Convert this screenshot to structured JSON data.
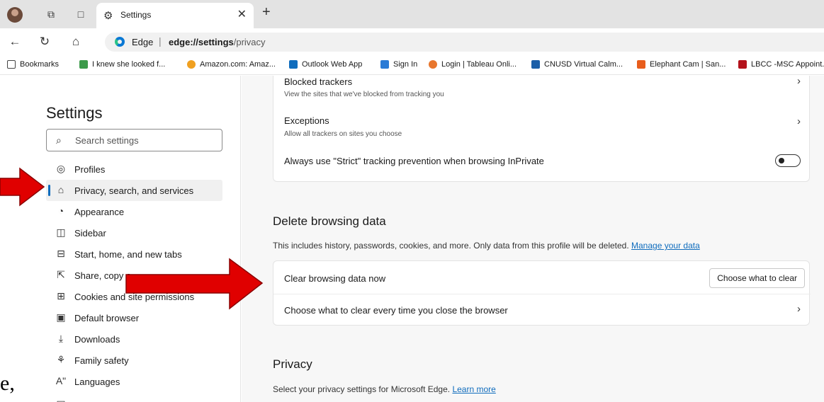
{
  "tab": {
    "title": "Settings"
  },
  "address": {
    "label": "Edge",
    "url_bold": "edge://settings",
    "url_rest": "/privacy"
  },
  "bookmarks": [
    {
      "label": "Bookmarks",
      "icon": "bookmarks-folder-icon",
      "color": "#444444"
    },
    {
      "label": "I knew she looked f...",
      "icon": "site-favicon",
      "color": "#3c9a4a"
    },
    {
      "label": "Amazon.com: Amaz...",
      "icon": "amazon-icon",
      "color": "#f0a020"
    },
    {
      "label": "Outlook Web App",
      "icon": "outlook-icon",
      "color": "#0f6cbd"
    },
    {
      "label": "Sign In",
      "icon": "signin-icon",
      "color": "#2a7bd6"
    },
    {
      "label": "Login | Tableau Onli...",
      "icon": "tableau-icon",
      "color": "#e8762d"
    },
    {
      "label": "CNUSD Virtual Calm...",
      "icon": "calendar-icon",
      "color": "#1c5fa8"
    },
    {
      "label": "Elephant Cam | San...",
      "icon": "elephant-cam-icon",
      "color": "#e85d1c"
    },
    {
      "label": "LBCC -MSC Appoint...",
      "icon": "lbcc-icon",
      "color": "#b3121b"
    }
  ],
  "sidebar": {
    "title": "Settings",
    "search_placeholder": "Search settings",
    "items": [
      {
        "label": "Profiles",
        "icon": "profile-icon"
      },
      {
        "label": "Privacy, search, and services",
        "icon": "lock-icon",
        "active": true
      },
      {
        "label": "Appearance",
        "icon": "appearance-icon"
      },
      {
        "label": "Sidebar",
        "icon": "sidebar-icon"
      },
      {
        "label": "Start, home, and new tabs",
        "icon": "home-tabs-icon"
      },
      {
        "label": "Share, copy a",
        "icon": "share-icon"
      },
      {
        "label": "Cookies and site permissions",
        "icon": "cookies-icon"
      },
      {
        "label": "Default browser",
        "icon": "browser-icon"
      },
      {
        "label": "Downloads",
        "icon": "download-icon"
      },
      {
        "label": "Family safety",
        "icon": "family-icon"
      },
      {
        "label": "Languages",
        "icon": "languages-icon"
      }
    ]
  },
  "tracking": {
    "blocked_title": "Blocked trackers",
    "blocked_desc": "View the sites that we've blocked from tracking you",
    "exceptions_title": "Exceptions",
    "exceptions_desc": "Allow all trackers on sites you choose",
    "strict_label": "Always use \"Strict\" tracking prevention when browsing InPrivate",
    "strict_on": false
  },
  "delete_data": {
    "title": "Delete browsing data",
    "desc": "This includes history, passwords, cookies, and more. Only data from this profile will be deleted.",
    "manage_link": "Manage your data",
    "clear_now": "Clear browsing data now",
    "choose_button": "Choose what to clear",
    "on_close": "Choose what to clear every time you close the browser"
  },
  "privacy": {
    "title": "Privacy",
    "desc": "Select your privacy settings for Microsoft Edge.",
    "learn_more": "Learn more"
  },
  "annotation": {
    "stray_text": "e,",
    "arrow_color": "#e00000"
  }
}
